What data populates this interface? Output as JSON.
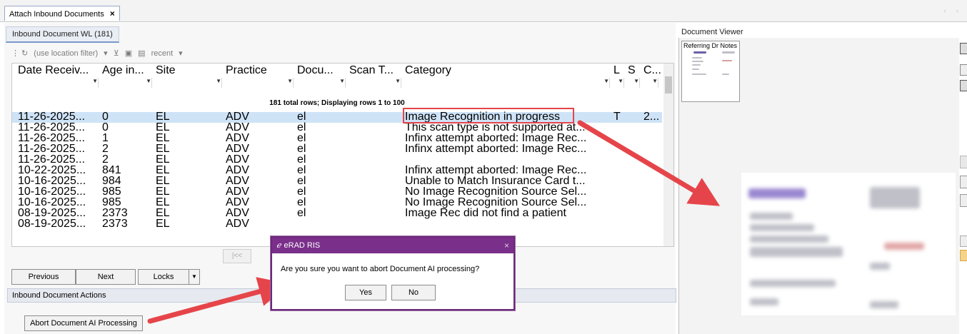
{
  "app": {
    "main_tab_label": "Attach Inbound Documents",
    "main_tab_close": "×",
    "tab_scroll_arrows": "‹ ›"
  },
  "worklist": {
    "tab_label": "Inbound Document WL (181)",
    "toolbar": {
      "location_filter": "(use location filter)",
      "recent_label": "recent"
    },
    "columns": [
      "Date Receiv...",
      "Age in...",
      "Site",
      "Practice",
      "Docu...",
      "Scan T...",
      "Category",
      "L",
      "S",
      "C..."
    ],
    "summary": "181 total rows;  Displaying rows 1 to 100",
    "rows": [
      [
        "11-26-2025...",
        "0",
        "EL",
        "ADV",
        "el",
        "",
        "Image Recognition in progress",
        "T",
        "",
        "2..."
      ],
      [
        "11-26-2025...",
        "0",
        "EL",
        "ADV",
        "el",
        "",
        "This scan type is not supported at...",
        "",
        "",
        ""
      ],
      [
        "11-26-2025...",
        "1",
        "EL",
        "ADV",
        "el",
        "",
        "Infinx attempt aborted: Image Rec...",
        "",
        "",
        ""
      ],
      [
        "11-26-2025...",
        "2",
        "EL",
        "ADV",
        "el",
        "",
        "Infinx attempt aborted: Image Rec...",
        "",
        "",
        ""
      ],
      [
        "11-26-2025...",
        "2",
        "EL",
        "ADV",
        "el",
        "",
        "",
        "",
        "",
        ""
      ],
      [
        "10-22-2025...",
        "841",
        "EL",
        "ADV",
        "el",
        "",
        "Infinx attempt aborted: Image Rec...",
        "",
        "",
        ""
      ],
      [
        "10-16-2025...",
        "984",
        "EL",
        "ADV",
        "el",
        "",
        "Unable to Match Insurance Card t...",
        "",
        "",
        ""
      ],
      [
        "10-16-2025...",
        "985",
        "EL",
        "ADV",
        "el",
        "",
        "No Image Recognition Source Sel...",
        "",
        "",
        ""
      ],
      [
        "10-16-2025...",
        "985",
        "EL",
        "ADV",
        "el",
        "",
        "No Image Recognition Source Sel...",
        "",
        "",
        ""
      ],
      [
        "08-19-2025...",
        "2373",
        "EL",
        "ADV",
        "el",
        "",
        "Image Rec did not find a patient",
        "",
        "",
        ""
      ],
      [
        "08-19-2025...",
        "2373",
        "EL",
        "ADV",
        "",
        "",
        "",
        "",
        "",
        ""
      ]
    ],
    "pager_first": "|<<",
    "buttons": {
      "previous": "Previous",
      "next": "Next",
      "locks": "Locks"
    }
  },
  "actions": {
    "section_title": "Inbound Document Actions",
    "abort_button": "Abort Document AI Processing"
  },
  "viewer": {
    "title": "Document Viewer",
    "thumbnail_label": "Referring Dr Notes"
  },
  "dialog": {
    "title": "eRAD RIS",
    "logo_glyph": "ℯ",
    "close": "×",
    "message": "Are you sure you want to abort Document AI processing?",
    "yes": "Yes",
    "no": "No"
  },
  "colors": {
    "annotation_red": "#e5454a",
    "dialog_purple": "#7a2f8a",
    "selection_blue": "#cfe3f7"
  }
}
